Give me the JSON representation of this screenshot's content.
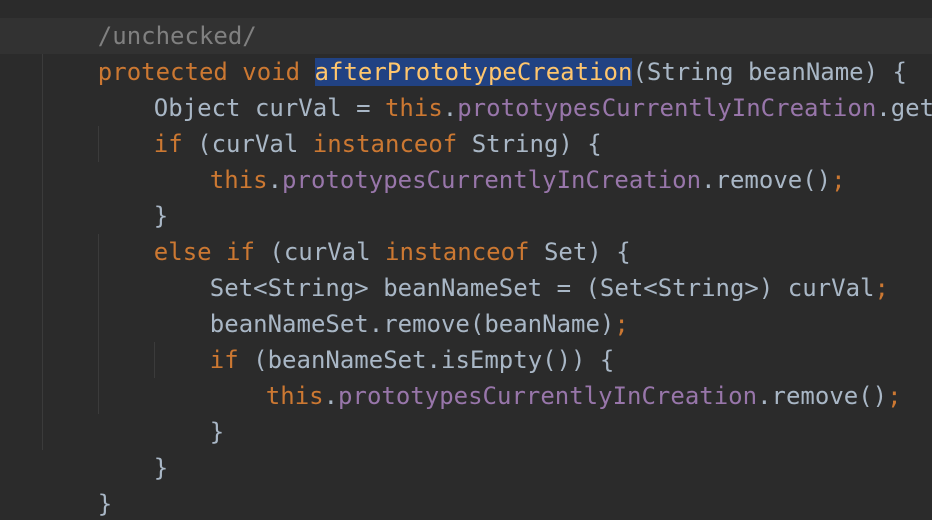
{
  "comment": "/unchecked/",
  "line1": {
    "kw_protected": "protected",
    "kw_void": "void",
    "method": "afterPrototypeCreation",
    "params": "(String beanName) {"
  },
  "line2": {
    "pre": "Object curVal = ",
    "this": "this",
    "dot": ".",
    "field": "prototypesCurrentlyInCreation",
    "post": ".get()",
    "semi": ";"
  },
  "line3": {
    "kw_if": "if",
    "mid1": " (curVal ",
    "kw_instanceof": "instanceof",
    "mid2": " String) {"
  },
  "line4": {
    "this": "this",
    "dot": ".",
    "field": "prototypesCurrentlyInCreation",
    "post": ".remove()",
    "semi": ";"
  },
  "line5": {
    "brace": "}"
  },
  "line6": {
    "kw_else": "else",
    "kw_if": "if",
    "mid1": " (curVal ",
    "kw_instanceof": "instanceof",
    "mid2": " Set) {"
  },
  "line7": {
    "text": "Set<String> beanNameSet = (Set<String>) curVal",
    "semi": ";"
  },
  "line8": {
    "text": "beanNameSet.remove(beanName)",
    "semi": ";"
  },
  "line9": {
    "kw_if": "if",
    "text": " (beanNameSet.isEmpty()) {"
  },
  "line10": {
    "this": "this",
    "dot": ".",
    "field": "prototypesCurrentlyInCreation",
    "post": ".remove()",
    "semi": ";"
  },
  "line11": {
    "brace": "}"
  },
  "line12": {
    "brace": "}"
  },
  "line13": {
    "brace": "}"
  },
  "colors": {
    "background": "#2b2b2b",
    "keyword": "#cc7832",
    "field": "#9876aa",
    "plain": "#a9b7c6",
    "selection": "#214283"
  }
}
